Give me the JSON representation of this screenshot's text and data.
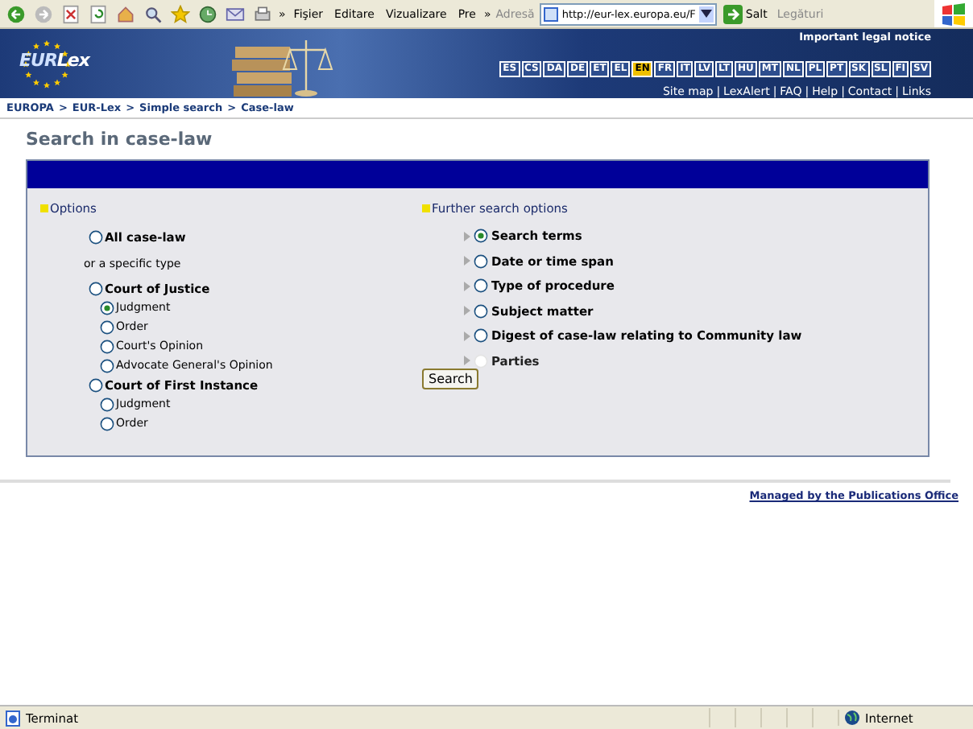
{
  "browser_toolbar": {
    "menu": [
      "Fişier",
      "Editare",
      "Vizualizare",
      "Pre"
    ],
    "chevrons": [
      "»",
      "»"
    ],
    "address_label": "Adresă",
    "address": "http://eur-lex.europa.eu/F",
    "go": "Salt",
    "links": "Legături"
  },
  "banner": {
    "logo": [
      "EUR",
      "Lex"
    ],
    "legal_notice": "Important legal notice",
    "languages": [
      {
        "code": "ES",
        "selected": false
      },
      {
        "code": "CS",
        "selected": false
      },
      {
        "code": "DA",
        "selected": false
      },
      {
        "code": "DE",
        "selected": false
      },
      {
        "code": "ET",
        "selected": false
      },
      {
        "code": "EL",
        "selected": false
      },
      {
        "code": "EN",
        "selected": true
      },
      {
        "code": "FR",
        "selected": false
      },
      {
        "code": "IT",
        "selected": false
      },
      {
        "code": "LV",
        "selected": false
      },
      {
        "code": "LT",
        "selected": false
      },
      {
        "code": "HU",
        "selected": false
      },
      {
        "code": "MT",
        "selected": false
      },
      {
        "code": "NL",
        "selected": false
      },
      {
        "code": "PL",
        "selected": false
      },
      {
        "code": "PT",
        "selected": false
      },
      {
        "code": "SK",
        "selected": false
      },
      {
        "code": "SL",
        "selected": false
      },
      {
        "code": "FI",
        "selected": false
      },
      {
        "code": "SV",
        "selected": false
      }
    ],
    "utility_links": [
      "Site map",
      "LexAlert",
      "FAQ",
      "Help",
      "Contact",
      "Links"
    ],
    "link_separator": "|"
  },
  "breadcrumb": {
    "items": [
      "EUROPA",
      "EUR-Lex",
      "Simple search",
      "Case-law"
    ],
    "separator": ">"
  },
  "page_title": "Search in case-law",
  "options": {
    "heading": "Options",
    "items": [
      {
        "kind": "main",
        "label": "All case-law",
        "selected": false
      },
      {
        "kind": "note",
        "label": "or a specific type"
      },
      {
        "kind": "main",
        "label": "Court of Justice",
        "selected": false
      },
      {
        "kind": "sub",
        "label": "Judgment",
        "selected": true
      },
      {
        "kind": "sub",
        "label": "Order",
        "selected": false
      },
      {
        "kind": "sub",
        "label": "Court's Opinion",
        "selected": false
      },
      {
        "kind": "sub",
        "label": "Advocate General's Opinion",
        "selected": false
      },
      {
        "kind": "main",
        "label": "Court of First Instance",
        "selected": false
      },
      {
        "kind": "sub",
        "label": "Judgment",
        "selected": false
      },
      {
        "kind": "sub",
        "label": "Order",
        "selected": false
      }
    ]
  },
  "further_options": {
    "heading": "Further search options",
    "items": [
      {
        "label": "Search terms",
        "selected": true,
        "disabled": false
      },
      {
        "label": "Date or time span",
        "selected": false,
        "disabled": false
      },
      {
        "label": "Type of procedure",
        "selected": false,
        "disabled": false
      },
      {
        "label": "Subject matter",
        "selected": false,
        "disabled": false
      },
      {
        "label": "Digest of case-law relating to Community law",
        "selected": false,
        "disabled": false
      },
      {
        "label": "Parties",
        "selected": false,
        "disabled": true
      }
    ],
    "search_button": "Search"
  },
  "footer_link": "Managed by the Publications Office",
  "status_bar": {
    "text": "Terminat",
    "zone": "Internet"
  }
}
